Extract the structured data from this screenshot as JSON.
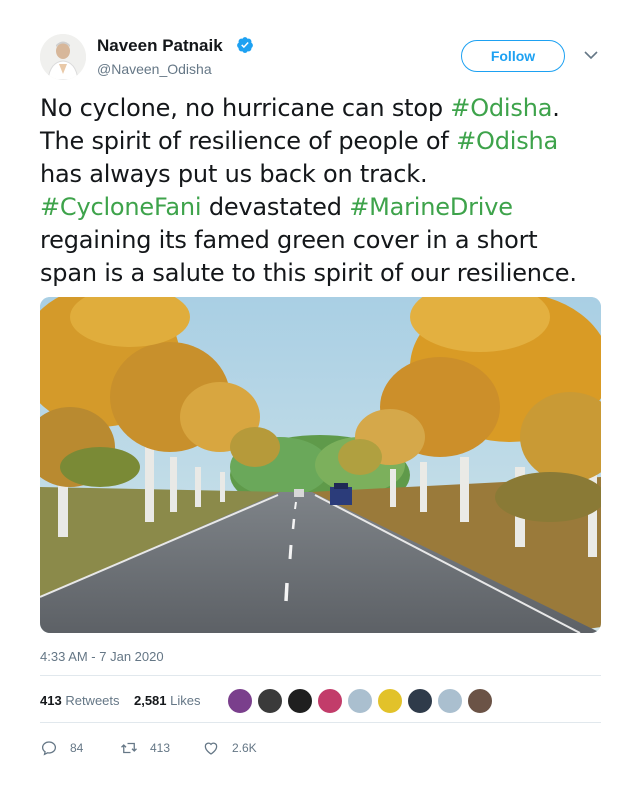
{
  "author": {
    "name": "Naveen Patnaik",
    "handle": "@Naveen_Odisha",
    "verified": true
  },
  "follow_button": {
    "label": "Follow"
  },
  "tweet": {
    "lines": [
      [
        {
          "t": "No cyclone, no hurricane can stop ",
          "tag": false
        },
        {
          "t": "#Odisha",
          "tag": true
        },
        {
          "t": ".",
          "tag": false
        }
      ],
      [
        {
          "t": "The spirit of resilience of people of ",
          "tag": false
        },
        {
          "t": "#Odisha",
          "tag": true
        }
      ],
      [
        {
          "t": " has always put us back on track.",
          "tag": false
        }
      ],
      [
        {
          "t": "#CycloneFani",
          "tag": true
        },
        {
          "t": " devastated ",
          "tag": false
        },
        {
          "t": "#MarineDrive",
          "tag": true
        }
      ],
      [
        {
          "t": " regaining its famed green cover in a short",
          "tag": false
        }
      ],
      [
        {
          "t": "span is a salute to this spirit of our resilience.",
          "tag": false
        }
      ]
    ]
  },
  "timestamp": "4:33 AM - 7 Jan 2020",
  "stats": {
    "retweets_count": "413",
    "retweets_label": "Retweets",
    "likes_count": "2,581",
    "likes_label": "Likes"
  },
  "actions": {
    "replies": "84",
    "retweets": "413",
    "likes": "2.6K"
  },
  "colors": {
    "hashtag": "#3ea34b",
    "accent": "#1da1f2",
    "secondary_text": "#657786"
  }
}
